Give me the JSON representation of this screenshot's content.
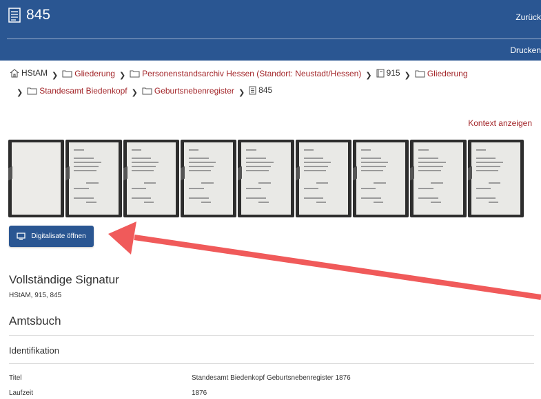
{
  "header": {
    "title": "845",
    "back_label": "Zurück",
    "print_label": "Drucken",
    "background_color": "#2a5692"
  },
  "breadcrumb": {
    "items": [
      {
        "label": "HStAM",
        "icon": "home-icon"
      },
      {
        "label": "Gliederung",
        "icon": "folder-icon"
      },
      {
        "label": "Personenstandsarchiv Hessen (Standort: Neustadt/Hessen)",
        "icon": "folder-icon"
      },
      {
        "label": "915",
        "icon": "book-icon"
      },
      {
        "label": "Gliederung",
        "icon": "folder-icon"
      },
      {
        "label": "Standesamt Biedenkopf",
        "icon": "folder-icon"
      },
      {
        "label": "Geburtsnebenregister",
        "icon": "folder-icon"
      },
      {
        "label": "845",
        "icon": "document-icon"
      }
    ],
    "link_color": "#a3262a"
  },
  "context_link": "Kontext anzeigen",
  "thumbnails_count": 9,
  "open_button": {
    "label": "Digitalisate öffnen",
    "icon": "monitor-icon"
  },
  "signature": {
    "heading": "Vollständige Signatur",
    "value": "HStAM, 915, 845"
  },
  "section_title": "Amtsbuch",
  "identification": {
    "heading": "Identifikation",
    "rows": [
      {
        "label": "Titel",
        "value": "Standesamt Biedenkopf Geburtsnebenregister 1876"
      },
      {
        "label": "Laufzeit",
        "value": "1876"
      }
    ]
  },
  "annotation": {
    "arrow_color": "#f05a5a",
    "icon": "red-arrow-icon"
  }
}
